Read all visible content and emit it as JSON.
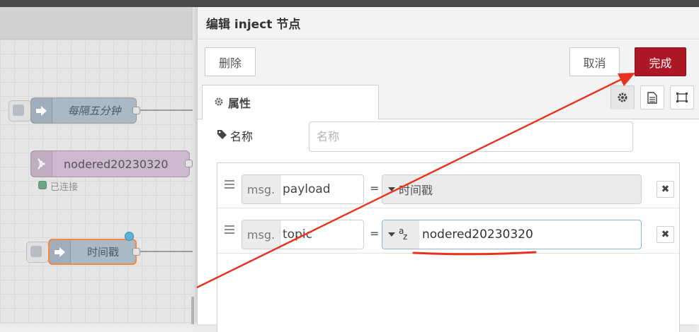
{
  "workspace": {
    "nodes": [
      {
        "label": "每隔五分钟",
        "icon": "arrow-icon"
      },
      {
        "label": "nodered20230320",
        "icon": "wifi-icon",
        "status": "已连接"
      },
      {
        "label": "时间戳",
        "icon": "arrow-icon"
      }
    ]
  },
  "tray": {
    "title": "编辑 inject 节点",
    "delete_label": "删除",
    "cancel_label": "取消",
    "done_label": "完成",
    "tab_label": "属性",
    "name_label": "名称",
    "name_placeholder": "名称",
    "name_value": "",
    "props": [
      {
        "prefix": "msg.",
        "key": "payload",
        "eq": "=",
        "type_label": "时间戳",
        "value": ""
      },
      {
        "prefix": "msg.",
        "key": "topic",
        "eq": "=",
        "type_label": "az",
        "value": "nodered20230320"
      }
    ],
    "remove_symbol": "✖"
  },
  "colors": {
    "primary": "#ad1625",
    "annotation_red": "#e8321e",
    "node_fill": "#a9b9c6",
    "status_green": "#6fa587",
    "changed_blue": "#5ab4d9"
  }
}
